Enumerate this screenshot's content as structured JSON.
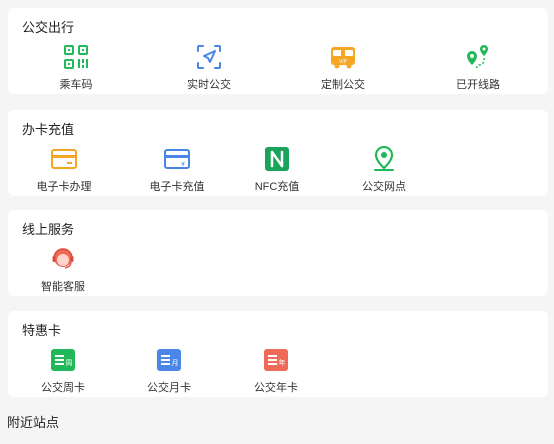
{
  "sections": [
    {
      "title": "公交出行",
      "items": [
        {
          "label": "乘车码",
          "icon": "qr-code-icon"
        },
        {
          "label": "实时公交",
          "icon": "navigation-arrow-icon"
        },
        {
          "label": "定制公交",
          "icon": "vip-bus-icon"
        },
        {
          "label": "已开线路",
          "icon": "route-map-pin-icon"
        }
      ]
    },
    {
      "title": "办卡充值",
      "items": [
        {
          "label": "电子卡办理",
          "icon": "card-icon"
        },
        {
          "label": "电子卡充值",
          "icon": "card-yen-icon"
        },
        {
          "label": "NFC充值",
          "icon": "nfc-icon"
        },
        {
          "label": "公交网点",
          "icon": "location-pin-icon"
        }
      ]
    },
    {
      "title": "线上服务",
      "items": [
        {
          "label": "智能客服",
          "icon": "customer-service-icon"
        }
      ]
    },
    {
      "title": "特惠卡",
      "items": [
        {
          "label": "公交周卡",
          "icon": "week-card-icon",
          "badge": "周"
        },
        {
          "label": "公交月卡",
          "icon": "month-card-icon",
          "badge": "月"
        },
        {
          "label": "公交年卡",
          "icon": "year-card-icon",
          "badge": "年"
        }
      ]
    }
  ],
  "nearby_title": "附近站点",
  "colors": {
    "green": "#20b858",
    "blue": "#4a86e8",
    "orange": "#f5a623",
    "red": "#f06a5a",
    "teal": "#1aa35a"
  }
}
